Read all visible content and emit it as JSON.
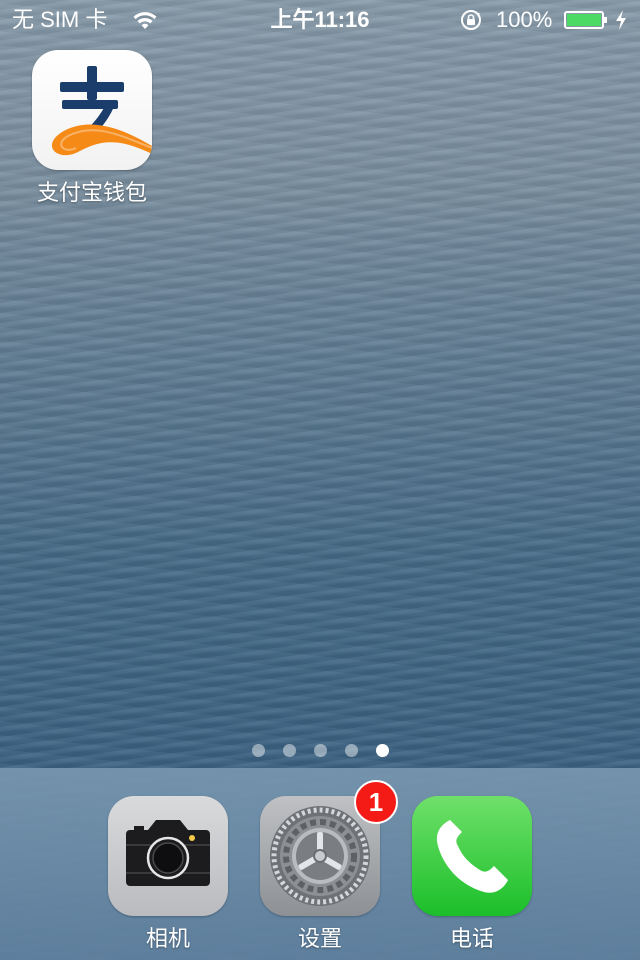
{
  "status_bar": {
    "carrier": "无 SIM 卡",
    "wifi_icon": "wifi-icon",
    "time": "上午11:16",
    "rotation_lock_icon": "rotation-lock-icon",
    "battery_percent": "100%",
    "battery_level": 1.0,
    "charging_icon": "bolt-icon"
  },
  "home": {
    "apps": [
      {
        "label": "支付宝钱包",
        "icon": "alipay-icon"
      }
    ],
    "page_count": 5,
    "current_page": 5
  },
  "dock": {
    "apps": [
      {
        "label": "相机",
        "icon": "camera-icon"
      },
      {
        "label": "设置",
        "icon": "settings-gear-icon",
        "badge": "1"
      },
      {
        "label": "电话",
        "icon": "phone-icon"
      }
    ]
  },
  "colors": {
    "alipay_blue": "#1b3d6b",
    "alipay_orange": "#f58a17",
    "badge_red": "#f41b17",
    "battery_green": "#4cd964"
  }
}
